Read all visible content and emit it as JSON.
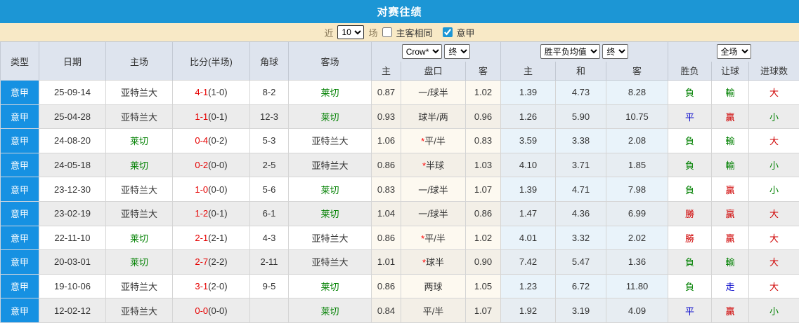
{
  "title_bar": {
    "title": "对赛往绩",
    "bg": "#1c96d5"
  },
  "filter_bar": {
    "near_label": "近",
    "near_count": "10",
    "games_label": "场",
    "same_venue_label": "主客相同",
    "same_venue_checked": false,
    "league_label": "意甲",
    "league_checked": true
  },
  "header": {
    "col_type": "类型",
    "col_date": "日期",
    "col_home": "主场",
    "col_score": "比分(半场)",
    "col_corner": "角球",
    "col_away": "客场",
    "odds_company": "Crow*",
    "odds_state": "终",
    "odds_home": "主",
    "odds_handicap": "盘口",
    "odds_away": "客",
    "avg_label": "胜平负均值",
    "avg_state": "终",
    "avg_home": "主",
    "avg_draw": "和",
    "avg_away": "客",
    "scope_label": "全场",
    "res_result": "胜负",
    "res_handicap": "让球",
    "res_goals": "进球数"
  },
  "rows": [
    {
      "league": "意甲",
      "date": "25-09-14",
      "home": "亚特兰大",
      "home_green": false,
      "score": "4-1",
      "half": "(1-0)",
      "corner": "8-2",
      "away": "莱切",
      "away_green": true,
      "odds_home": "0.87",
      "handicap_star": false,
      "handicap": "一/球半",
      "odds_away": "1.02",
      "avg_home": "1.39",
      "avg_draw": "4.73",
      "avg_away": "8.28",
      "result": "負",
      "result_c": "green",
      "let": "輸",
      "let_c": "green",
      "goals": "大",
      "goals_c": "red"
    },
    {
      "league": "意甲",
      "date": "25-04-28",
      "home": "亚特兰大",
      "home_green": false,
      "score": "1-1",
      "half": "(0-1)",
      "corner": "12-3",
      "away": "莱切",
      "away_green": true,
      "odds_home": "0.93",
      "handicap_star": false,
      "handicap": "球半/两",
      "odds_away": "0.96",
      "avg_home": "1.26",
      "avg_draw": "5.90",
      "avg_away": "10.75",
      "result": "平",
      "result_c": "blue",
      "let": "贏",
      "let_c": "red",
      "goals": "小",
      "goals_c": "green"
    },
    {
      "league": "意甲",
      "date": "24-08-20",
      "home": "莱切",
      "home_green": true,
      "score": "0-4",
      "half": "(0-2)",
      "corner": "5-3",
      "away": "亚特兰大",
      "away_green": false,
      "odds_home": "1.06",
      "handicap_star": true,
      "handicap": "平/半",
      "odds_away": "0.83",
      "avg_home": "3.59",
      "avg_draw": "3.38",
      "avg_away": "2.08",
      "result": "負",
      "result_c": "green",
      "let": "輸",
      "let_c": "green",
      "goals": "大",
      "goals_c": "red"
    },
    {
      "league": "意甲",
      "date": "24-05-18",
      "home": "莱切",
      "home_green": true,
      "score": "0-2",
      "half": "(0-0)",
      "corner": "2-5",
      "away": "亚特兰大",
      "away_green": false,
      "odds_home": "0.86",
      "handicap_star": true,
      "handicap": "半球",
      "odds_away": "1.03",
      "avg_home": "4.10",
      "avg_draw": "3.71",
      "avg_away": "1.85",
      "result": "負",
      "result_c": "green",
      "let": "輸",
      "let_c": "green",
      "goals": "小",
      "goals_c": "green"
    },
    {
      "league": "意甲",
      "date": "23-12-30",
      "home": "亚特兰大",
      "home_green": false,
      "score": "1-0",
      "half": "(0-0)",
      "corner": "5-6",
      "away": "莱切",
      "away_green": true,
      "odds_home": "0.83",
      "handicap_star": false,
      "handicap": "一/球半",
      "odds_away": "1.07",
      "avg_home": "1.39",
      "avg_draw": "4.71",
      "avg_away": "7.98",
      "result": "負",
      "result_c": "green",
      "let": "贏",
      "let_c": "red",
      "goals": "小",
      "goals_c": "green"
    },
    {
      "league": "意甲",
      "date": "23-02-19",
      "home": "亚特兰大",
      "home_green": false,
      "score": "1-2",
      "half": "(0-1)",
      "corner": "6-1",
      "away": "莱切",
      "away_green": true,
      "odds_home": "1.04",
      "handicap_star": false,
      "handicap": "一/球半",
      "odds_away": "0.86",
      "avg_home": "1.47",
      "avg_draw": "4.36",
      "avg_away": "6.99",
      "result": "勝",
      "result_c": "red",
      "let": "贏",
      "let_c": "red",
      "goals": "大",
      "goals_c": "red"
    },
    {
      "league": "意甲",
      "date": "22-11-10",
      "home": "莱切",
      "home_green": true,
      "score": "2-1",
      "half": "(2-1)",
      "corner": "4-3",
      "away": "亚特兰大",
      "away_green": false,
      "odds_home": "0.86",
      "handicap_star": true,
      "handicap": "平/半",
      "odds_away": "1.02",
      "avg_home": "4.01",
      "avg_draw": "3.32",
      "avg_away": "2.02",
      "result": "勝",
      "result_c": "red",
      "let": "贏",
      "let_c": "red",
      "goals": "大",
      "goals_c": "red"
    },
    {
      "league": "意甲",
      "date": "20-03-01",
      "home": "莱切",
      "home_green": true,
      "score": "2-7",
      "half": "(2-2)",
      "corner": "2-11",
      "away": "亚特兰大",
      "away_green": false,
      "odds_home": "1.01",
      "handicap_star": true,
      "handicap": "球半",
      "odds_away": "0.90",
      "avg_home": "7.42",
      "avg_draw": "5.47",
      "avg_away": "1.36",
      "result": "負",
      "result_c": "green",
      "let": "輸",
      "let_c": "green",
      "goals": "大",
      "goals_c": "red"
    },
    {
      "league": "意甲",
      "date": "19-10-06",
      "home": "亚特兰大",
      "home_green": false,
      "score": "3-1",
      "half": "(2-0)",
      "corner": "9-5",
      "away": "莱切",
      "away_green": true,
      "odds_home": "0.86",
      "handicap_star": false,
      "handicap": "两球",
      "odds_away": "1.05",
      "avg_home": "1.23",
      "avg_draw": "6.72",
      "avg_away": "11.80",
      "result": "負",
      "result_c": "green",
      "let": "走",
      "let_c": "blue",
      "goals": "大",
      "goals_c": "red"
    },
    {
      "league": "意甲",
      "date": "12-02-12",
      "home": "亚特兰大",
      "home_green": false,
      "score": "0-0",
      "half": "(0-0)",
      "corner": "",
      "away": "莱切",
      "away_green": true,
      "odds_home": "0.84",
      "handicap_star": false,
      "handicap": "平/半",
      "odds_away": "1.07",
      "avg_home": "1.92",
      "avg_draw": "3.19",
      "avg_away": "4.09",
      "result": "平",
      "result_c": "blue",
      "let": "贏",
      "let_c": "red",
      "goals": "小",
      "goals_c": "green"
    }
  ]
}
